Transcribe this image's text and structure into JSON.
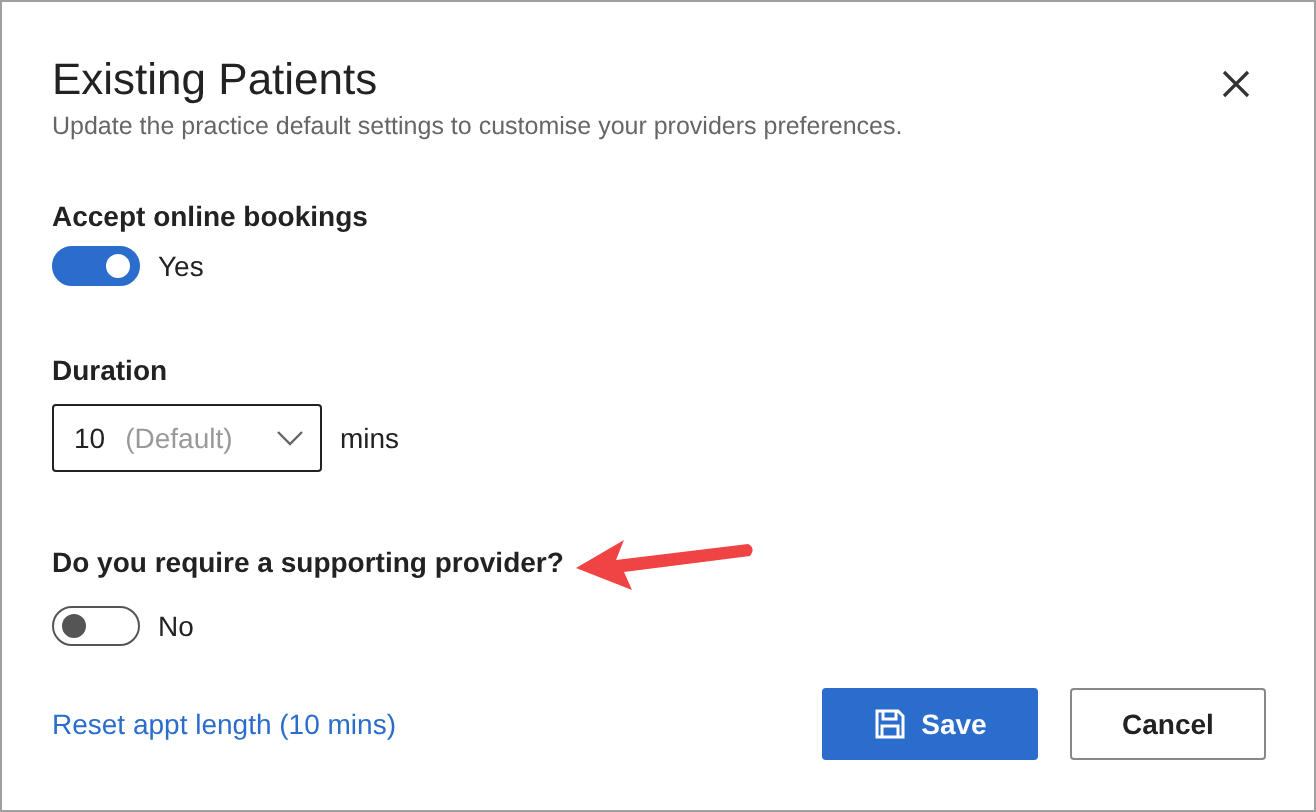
{
  "dialog": {
    "title": "Existing Patients",
    "subtitle": "Update the practice default settings to customise your providers preferences."
  },
  "fields": [
    {
      "kind": "toggle",
      "label": "Accept online bookings",
      "on": true,
      "state_text": "Yes"
    },
    {
      "kind": "select",
      "label": "Duration",
      "value": "10",
      "hint": "(Default)",
      "unit": "mins"
    },
    {
      "kind": "toggle",
      "label": "Do you require a supporting provider?",
      "on": false,
      "state_text": "No",
      "annotated": true
    }
  ],
  "footer": {
    "link": "Reset appt length (10 mins)",
    "buttons": [
      {
        "label": "Save",
        "kind": "primary"
      },
      {
        "label": "Cancel",
        "kind": "secondary"
      }
    ]
  }
}
